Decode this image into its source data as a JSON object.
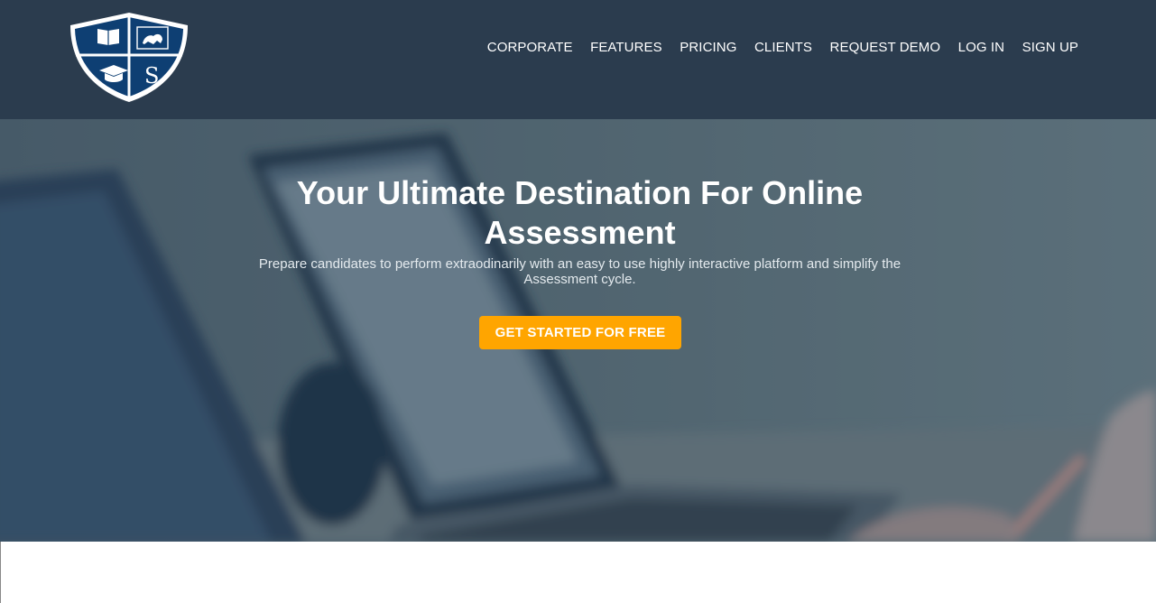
{
  "logo": {
    "icon": "shield-crest-icon",
    "letter": "S"
  },
  "nav": {
    "items": [
      "CORPORATE",
      "FEATURES",
      "PRICING",
      "CLIENTS",
      "REQUEST DEMO",
      "LOG IN",
      "SIGN UP"
    ]
  },
  "hero": {
    "title": "Your Ultimate Destination For Online Assessment",
    "subtitle": "Prepare candidates to perform extraodinarily with an easy to use highly interactive platform and simplify the Assessment cycle.",
    "cta_label": "GET STARTED FOR FREE",
    "background_icon": "laptop-photo-background"
  },
  "colors": {
    "header_bg": "#2b3c4e",
    "cta_bg": "#ffa500",
    "logo_blue": "#0e3f73"
  }
}
